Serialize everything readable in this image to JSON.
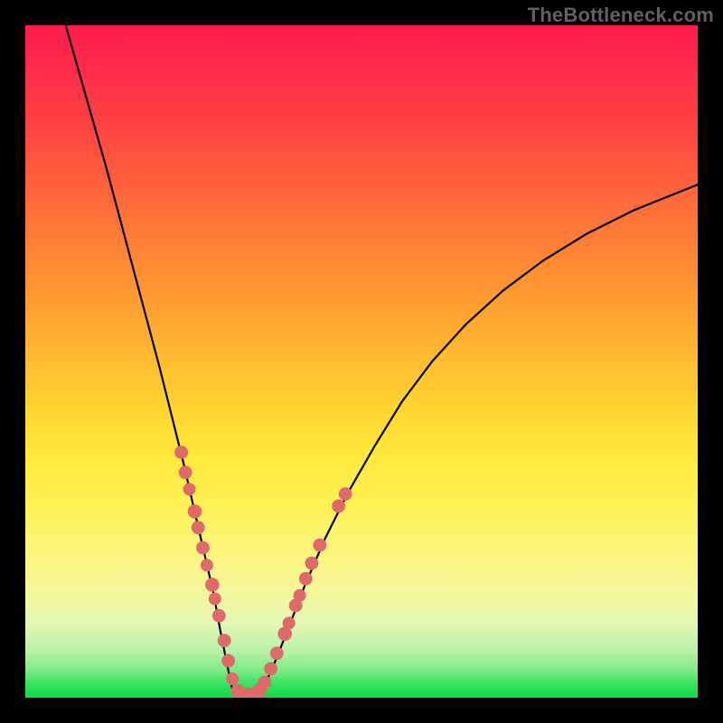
{
  "watermark": "TheBottleneck.com",
  "chart_data": {
    "type": "line",
    "title": "",
    "xlabel": "",
    "ylabel": "",
    "xlim": [
      0,
      100
    ],
    "ylim": [
      0,
      100
    ],
    "series": [
      {
        "name": "curve-left",
        "x": [
          6,
          8,
          10,
          12,
          14,
          16,
          18,
          20,
          22,
          23.5,
          25,
          26.5,
          28,
          29,
          30,
          30.8
        ],
        "y": [
          100,
          93,
          86,
          79,
          71.5,
          64,
          56.5,
          49,
          41,
          35,
          28.5,
          22,
          15.5,
          10,
          5,
          1.2
        ]
      },
      {
        "name": "curve-valley",
        "x": [
          30.8,
          31.5,
          32.5,
          33.5,
          34.5,
          35.3
        ],
        "y": [
          1.2,
          0.5,
          0.3,
          0.3,
          0.5,
          1.2
        ]
      },
      {
        "name": "curve-right",
        "x": [
          35.3,
          37,
          39,
          41.5,
          44.5,
          48,
          52,
          56,
          60.5,
          65.5,
          71,
          77,
          83.5,
          90.5,
          98,
          100
        ],
        "y": [
          1.2,
          5,
          10,
          16.5,
          23.5,
          30.5,
          37.5,
          44,
          50,
          55.5,
          60.5,
          65,
          69,
          72.5,
          75.5,
          76.3
        ]
      }
    ],
    "dots": {
      "name": "data-dots",
      "color": "#e06a6a",
      "points": [
        {
          "x": 23.2,
          "y": 36.5,
          "r": 1.3
        },
        {
          "x": 23.8,
          "y": 33.5,
          "r": 1.3
        },
        {
          "x": 24.4,
          "y": 31.0,
          "r": 1.2
        },
        {
          "x": 25.2,
          "y": 27.7,
          "r": 1.4
        },
        {
          "x": 25.7,
          "y": 25.3,
          "r": 1.3
        },
        {
          "x": 26.4,
          "y": 22.3,
          "r": 1.3
        },
        {
          "x": 27.0,
          "y": 19.7,
          "r": 1.2
        },
        {
          "x": 27.8,
          "y": 16.8,
          "r": 1.4
        },
        {
          "x": 28.2,
          "y": 14.7,
          "r": 1.2
        },
        {
          "x": 28.8,
          "y": 12.2,
          "r": 1.3
        },
        {
          "x": 29.6,
          "y": 8.5,
          "r": 1.3
        },
        {
          "x": 30.2,
          "y": 5.5,
          "r": 1.3
        },
        {
          "x": 30.8,
          "y": 2.8,
          "r": 1.2
        },
        {
          "x": 31.6,
          "y": 1.0,
          "r": 1.4
        },
        {
          "x": 32.4,
          "y": 0.5,
          "r": 1.3
        },
        {
          "x": 33.2,
          "y": 0.5,
          "r": 1.3
        },
        {
          "x": 34.0,
          "y": 0.6,
          "r": 1.3
        },
        {
          "x": 34.8,
          "y": 1.1,
          "r": 1.4
        },
        {
          "x": 35.6,
          "y": 2.3,
          "r": 1.3
        },
        {
          "x": 36.5,
          "y": 4.3,
          "r": 1.3
        },
        {
          "x": 37.4,
          "y": 6.6,
          "r": 1.3
        },
        {
          "x": 38.6,
          "y": 9.5,
          "r": 1.4
        },
        {
          "x": 39.2,
          "y": 11.1,
          "r": 1.2
        },
        {
          "x": 40.2,
          "y": 13.7,
          "r": 1.3
        },
        {
          "x": 40.8,
          "y": 15.2,
          "r": 1.2
        },
        {
          "x": 41.7,
          "y": 17.7,
          "r": 1.3
        },
        {
          "x": 42.6,
          "y": 20.0,
          "r": 1.3
        },
        {
          "x": 43.8,
          "y": 22.7,
          "r": 1.3
        },
        {
          "x": 46.6,
          "y": 28.5,
          "r": 1.3
        },
        {
          "x": 47.6,
          "y": 30.3,
          "r": 1.3
        }
      ]
    },
    "gradient_stops": [
      {
        "pos": 0,
        "color": "#ff1a4d"
      },
      {
        "pos": 100,
        "color": "#10db48"
      }
    ]
  }
}
